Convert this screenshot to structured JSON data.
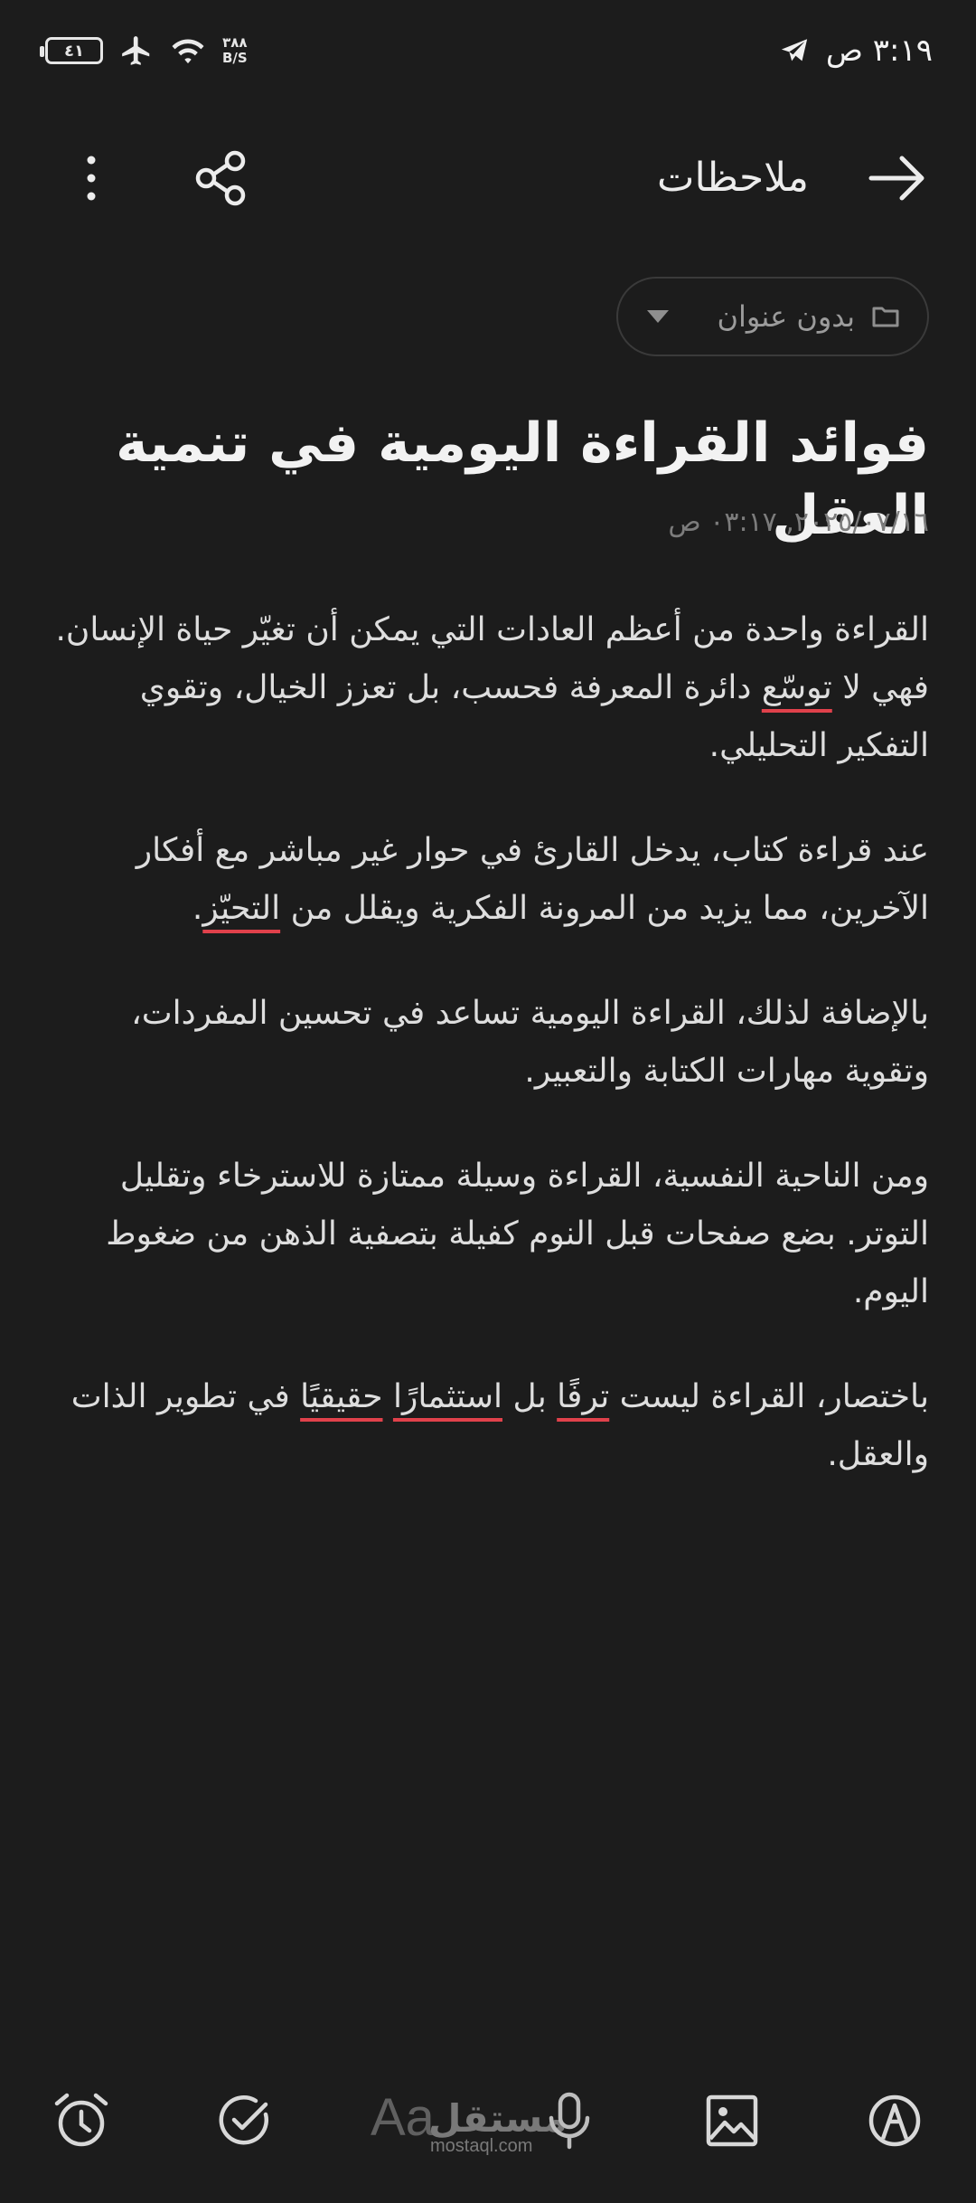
{
  "status_bar": {
    "time": "٣:١٩ ص",
    "battery": "٤١",
    "net_speed_value": "٣٨٨",
    "net_speed_unit": "B/S"
  },
  "header": {
    "title": "ملاحظات"
  },
  "folder": {
    "label": "بدون عنوان"
  },
  "note": {
    "title": "فوائد القراءة اليومية في تنمية العقل",
    "date": "٢٠٢٥/٠٧/١٦, ٠٣:١٧ ص",
    "p1_a": "القراءة واحدة من أعظم العادات التي يمكن أن تغيّر حياة الإنسان. فهي لا ",
    "p1_err": "توسّع",
    "p1_b": " دائرة المعرفة فحسب، بل تعزز الخيال، وتقوي التفكير التحليلي.",
    "p2_a": "عند قراءة كتاب، يدخل القارئ في حوار غير مباشر مع أفكار الآخرين، مما يزيد من المرونة الفكرية ويقلل من ",
    "p2_err": "التحيّز",
    "p2_b": ".",
    "p3": "بالإضافة لذلك، القراءة اليومية تساعد في تحسين المفردات، وتقوية مهارات الكتابة والتعبير.",
    "p4": "ومن الناحية النفسية، القراءة وسيلة ممتازة للاسترخاء وتقليل التوتر. بضع صفحات قبل النوم كفيلة بتصفية الذهن من ضغوط اليوم.",
    "p5_a": "باختصار، القراءة ليست ",
    "p5_err1": "ترفًا",
    "p5_b": " بل ",
    "p5_err2": "استثمارًا",
    "p5_c": " ",
    "p5_err3": "حقيقيًا",
    "p5_d": " في تطوير الذات والعقل."
  },
  "watermark": {
    "aa": "Aa",
    "brand": "مستقل",
    "domain": "mostaql.com"
  },
  "colors": {
    "background": "#1c1c1c",
    "spell_underline": "#e0414b",
    "muted_text": "#7c7c7c"
  }
}
